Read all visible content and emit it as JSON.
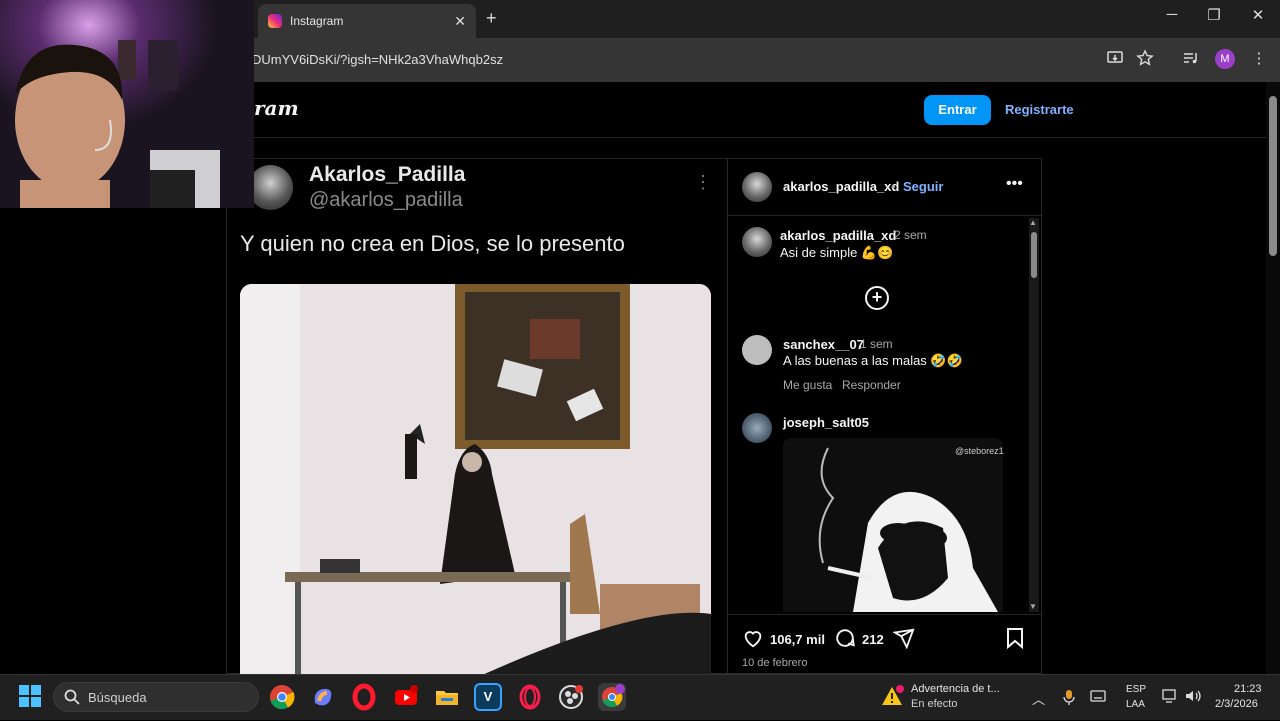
{
  "browser": {
    "tab_title": "Instagram",
    "close_tab": "✕",
    "new_tab": "+",
    "url": "DUmYV6iDsKi/?igsh=NHk2a3VhaWhqb2sz",
    "profile_initial": "M",
    "minimize": "─",
    "restore": "❐",
    "close": "✕"
  },
  "instagram": {
    "logo": "ram",
    "login_button": "Entrar",
    "signup_link": "Registrarte"
  },
  "post": {
    "author_name": "Akarlos_Padilla",
    "author_handle": "@akarlos_padilla",
    "menu": "⋮",
    "caption": "Y quien no crea en Dios, se lo presento"
  },
  "panel": {
    "username": "akarlos_padilla_xd",
    "separator": "•",
    "follow": "Seguir",
    "more": "•••",
    "comments": [
      {
        "user": "akarlos_padilla_xd",
        "time": "2 sem",
        "text": "Asi de simple 💪😊"
      },
      {
        "user": "sanchex__07",
        "time": "1 sem",
        "text": "A las buenas a las malas 🤣🤣",
        "like": "Me gusta",
        "reply": "Responder"
      },
      {
        "user": "joseph_salt05",
        "image_tag": "@steborez1"
      }
    ],
    "load_more": "+",
    "likes": "106,7 mil",
    "comment_count": "212",
    "date": "10 de febrero"
  },
  "taskbar": {
    "search_placeholder": "Búsqueda",
    "vs_label": "V",
    "warning_title": "Advertencia de t...",
    "warning_sub": "En efecto",
    "lang_top": "ESP",
    "lang_bottom": "LAA",
    "time": "21:23",
    "date": "2/3/2026"
  },
  "colors": {
    "accent": "#0095f6",
    "link": "#7fb2ff",
    "bg": "#000000"
  }
}
